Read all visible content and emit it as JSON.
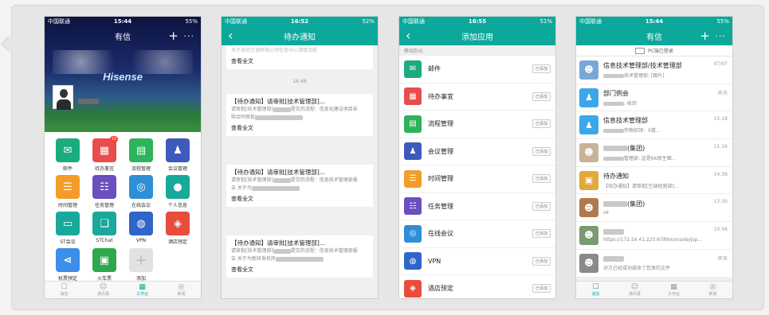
{
  "status": {
    "carrier": "中国联通",
    "batt1": "55%",
    "batt2": "52%",
    "batt3": "51%",
    "batt4": "55%",
    "time1": "15:44",
    "time2": "16:52",
    "time3": "16:55",
    "time4": "15:44"
  },
  "p1": {
    "title": "有信",
    "brand": "Hisense",
    "plus": "+",
    "more": "···",
    "apps": [
      {
        "label": "邮件",
        "color": "#1aab7f",
        "icon": "envelope-icon",
        "glyph": "✉"
      },
      {
        "label": "待办事宜",
        "color": "#e84c4c",
        "icon": "calendar-icon",
        "glyph": "▦",
        "badge": "12"
      },
      {
        "label": "流程管理",
        "color": "#2db35a",
        "icon": "document-icon",
        "glyph": "▤"
      },
      {
        "label": "会议管理",
        "color": "#3c5bbd",
        "icon": "people-icon",
        "glyph": "♟"
      },
      {
        "label": "时间管理",
        "color": "#f39c2a",
        "icon": "clock-list-icon",
        "glyph": "☰"
      },
      {
        "label": "任务管理",
        "color": "#6b4fbf",
        "icon": "task-icon",
        "glyph": "☷"
      },
      {
        "label": "在线会议",
        "color": "#2e8fd6",
        "icon": "online-meeting-icon",
        "glyph": "◎"
      },
      {
        "label": "个人信息",
        "color": "#1aa89b",
        "icon": "person-icon",
        "glyph": "●"
      },
      {
        "label": "ST会议",
        "color": "#1aa89b",
        "icon": "board-icon",
        "glyph": "▭"
      },
      {
        "label": "STChat",
        "color": "#1aa89b",
        "icon": "chat-icon",
        "glyph": "❏"
      },
      {
        "label": "VPN",
        "color": "#2f65c8",
        "icon": "globe-icon",
        "glyph": "◍"
      },
      {
        "label": "酒店预定",
        "color": "#e84c3d",
        "icon": "layers-icon",
        "glyph": "◈"
      },
      {
        "label": "机票预定",
        "color": "#3c8ee8",
        "icon": "share-icon",
        "glyph": "⋖"
      },
      {
        "label": "火车票",
        "color": "#2ea84d",
        "icon": "train-icon",
        "glyph": "▣"
      },
      {
        "label": "添加",
        "color": "#e2e2e2",
        "icon": "add-icon",
        "glyph": "+"
      }
    ],
    "tabs": [
      "消息",
      "通讯录",
      "工作台",
      "新闻"
    ]
  },
  "p2": {
    "title": "待办通知",
    "view_all": "查看全文",
    "time": "16:48",
    "top_snippet": "关于海信空调有限公司信息中心请假流程",
    "cards": [
      {
        "t": "【待办通知】请审批[技术管理部]...",
        "s1": "请审批[技术管理部]",
        "s1b": "提交的流程：信息化建设项目采",
        "s2": "购合同审批"
      },
      {
        "t": "【待办通知】请审批[技术管理部]...",
        "s1": "请审批[技术管理部]",
        "s1b": "提交的流程：信息技术管理部报",
        "s2": "告 关于为"
      },
      {
        "t": "【待办通知】请审批[技术管理部]...",
        "s1": "请审批[技术管理部]",
        "s1b": "提交的流程：信息技术管理部报",
        "s2": "告 关于为新研发机房"
      }
    ]
  },
  "p3": {
    "title": "添加应用",
    "section": "移动办公",
    "added": "已添加",
    "apps": [
      {
        "name": "邮件",
        "color": "#1aab7f",
        "icon": "envelope-icon",
        "glyph": "✉"
      },
      {
        "name": "待办事宜",
        "color": "#e84c4c",
        "icon": "calendar-icon",
        "glyph": "▦"
      },
      {
        "name": "流程管理",
        "color": "#2db35a",
        "icon": "document-icon",
        "glyph": "▤"
      },
      {
        "name": "会议管理",
        "color": "#3c5bbd",
        "icon": "people-icon",
        "glyph": "♟"
      },
      {
        "name": "时间管理",
        "color": "#f39c2a",
        "icon": "clock-list-icon",
        "glyph": "☰"
      },
      {
        "name": "任务管理",
        "color": "#6b4fbf",
        "icon": "task-icon",
        "glyph": "☷"
      },
      {
        "name": "在线会议",
        "color": "#2e8fd6",
        "icon": "online-meeting-icon",
        "glyph": "◎"
      },
      {
        "name": "VPN",
        "color": "#2f65c8",
        "icon": "globe-icon",
        "glyph": "◍"
      },
      {
        "name": "酒店预定",
        "color": "#e84c3d",
        "icon": "layers-icon",
        "glyph": "◈"
      }
    ]
  },
  "p4": {
    "title": "有信",
    "pc": "PC端已登录",
    "chats": [
      {
        "name": "信息技术管理部/技术管理部",
        "preview": "技术管理部: [图片]",
        "time": "07/07",
        "color": "#7aa7d8",
        "glyph": "☻"
      },
      {
        "name": "部门例会",
        "preview": ": 收到",
        "time": "昨天",
        "color": "#3aa8e8",
        "glyph": "♟"
      },
      {
        "name": "信息技术管理部",
        "preview": "失物招领：5楼...",
        "time": "15:18",
        "color": "#3aa8e8",
        "glyph": "♟"
      },
      {
        "name": "(集团)",
        "preview": "管理部: 这是KK原生图...",
        "time": "15:16",
        "color": "#c7b39a",
        "glyph": "☻"
      },
      {
        "name": "待办通知",
        "preview": "【待办通知】请审批[空调经营部]...",
        "time": "14:36",
        "color": "#e0a93a",
        "glyph": "▣"
      },
      {
        "name": "(集团)",
        "preview": "ok",
        "time": "13:30",
        "color": "#b07a50",
        "glyph": "☻"
      },
      {
        "name": "",
        "preview": "https://172.16.41.225:6789/console/jsp...",
        "time": "10:56",
        "color": "#7a9a70",
        "glyph": "☻"
      },
      {
        "name": "",
        "preview": "对方已经成功接收了您发的文件",
        "time": "昨天",
        "color": "#8a8a8a",
        "glyph": "☻"
      }
    ]
  }
}
